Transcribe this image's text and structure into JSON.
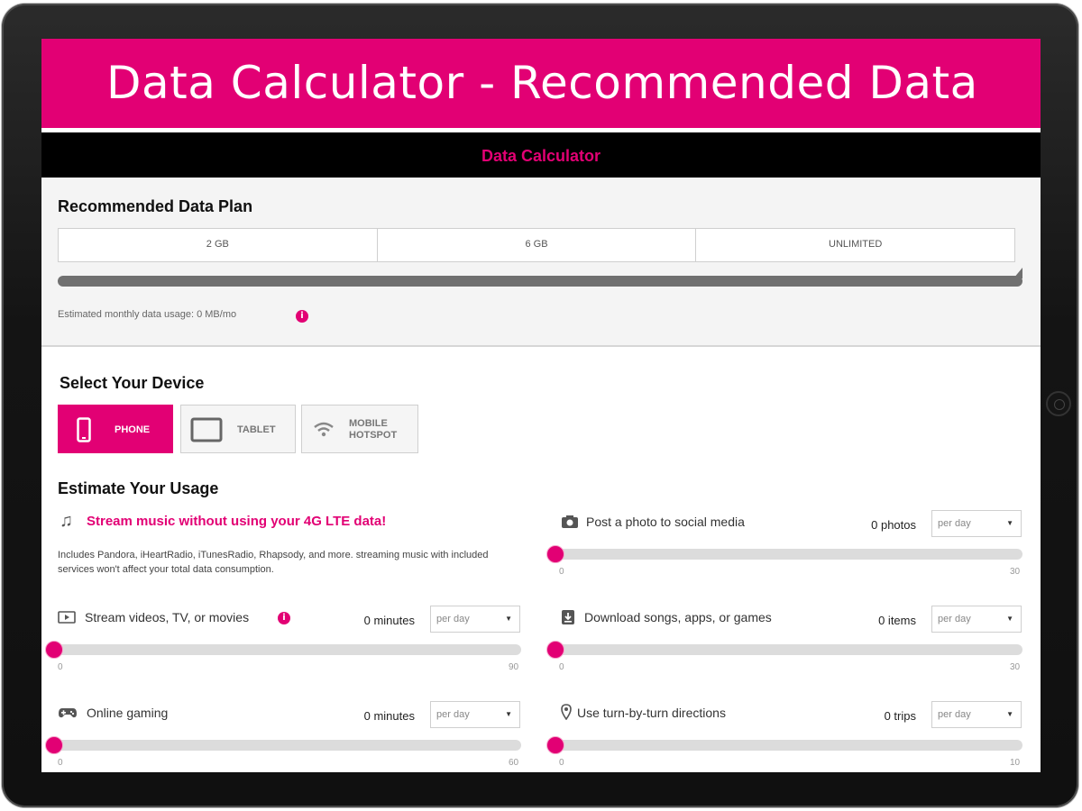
{
  "banner": {
    "title": "Data Calculator - Recommended Data"
  },
  "nav": {
    "title": "Data Calculator"
  },
  "plan": {
    "heading": "Recommended Data Plan",
    "tiers": [
      "2 GB",
      "6 GB",
      "UNLIMITED"
    ],
    "progress": 0,
    "estimate_text": "Estimated monthly data usage: 0 MB/mo",
    "info_glyph": "i"
  },
  "device": {
    "heading": "Select Your Device",
    "options": [
      {
        "label": "PHONE",
        "icon": "phone-icon",
        "selected": true
      },
      {
        "label": "TABLET",
        "icon": "tablet-icon",
        "selected": false
      },
      {
        "label_line1": "MOBILE",
        "label_line2": "HOTSPOT",
        "icon": "wifi-icon",
        "selected": false
      }
    ]
  },
  "usage": {
    "heading": "Estimate Your Usage",
    "music": {
      "title": "Stream music without using your 4G LTE data!",
      "description": "Includes Pandora, iHeartRadio, iTunesRadio, Rhapsody, and more. streaming music with included services won't affect your total data consumption."
    },
    "items": {
      "photo": {
        "label": "Post a photo to social media",
        "count": "0 photos",
        "period": "per day",
        "min": "0",
        "max": "30",
        "value": 0
      },
      "video": {
        "label": "Stream videos, TV, or movies",
        "count": "0 minutes",
        "period": "per day",
        "min": "0",
        "max": "90",
        "value": 0
      },
      "download": {
        "label": "Download songs, apps, or games",
        "count": "0 items",
        "period": "per day",
        "min": "0",
        "max": "30",
        "value": 0
      },
      "gaming": {
        "label": "Online gaming",
        "count": "0 minutes",
        "period": "per day",
        "min": "0",
        "max": "60",
        "value": 0
      },
      "directions": {
        "label": "Use turn-by-turn directions",
        "count": "0 trips",
        "period": "per day",
        "min": "0",
        "max": "10",
        "value": 0
      }
    }
  },
  "colors": {
    "brand": "#e20074",
    "nav": "#000000",
    "track": "#dcdcdc",
    "plan_bar": "#707070"
  }
}
